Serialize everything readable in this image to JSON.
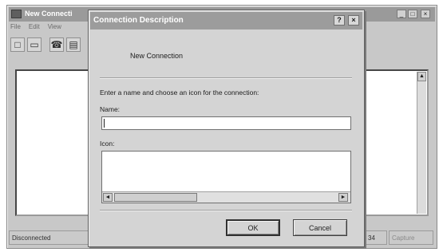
{
  "main_window": {
    "title": "New Connecti",
    "menu": [
      "File",
      "Edit",
      "View"
    ],
    "toolbar_icons": [
      "new-icon",
      "open-icon",
      "properties-icon",
      "print-icon"
    ],
    "status": {
      "connection": "Disconnected",
      "time": "34",
      "capture": "Capture"
    },
    "window_controls": {
      "minimize": "_",
      "maximize": "□",
      "close": "×"
    }
  },
  "dialog": {
    "title": "Connection Description",
    "help_button": "?",
    "close_button": "×",
    "connection_name": "New Connection",
    "instructions": "Enter a name and choose an icon for the connection:",
    "name_label": "Name:",
    "name_value": "",
    "icon_label": "Icon:",
    "scroll_left": "◄",
    "scroll_right": "►",
    "ok_label": "OK",
    "cancel_label": "Cancel"
  },
  "colors": {
    "titlebar": "#9c9c9c",
    "window_face": "#d4d4d4"
  }
}
